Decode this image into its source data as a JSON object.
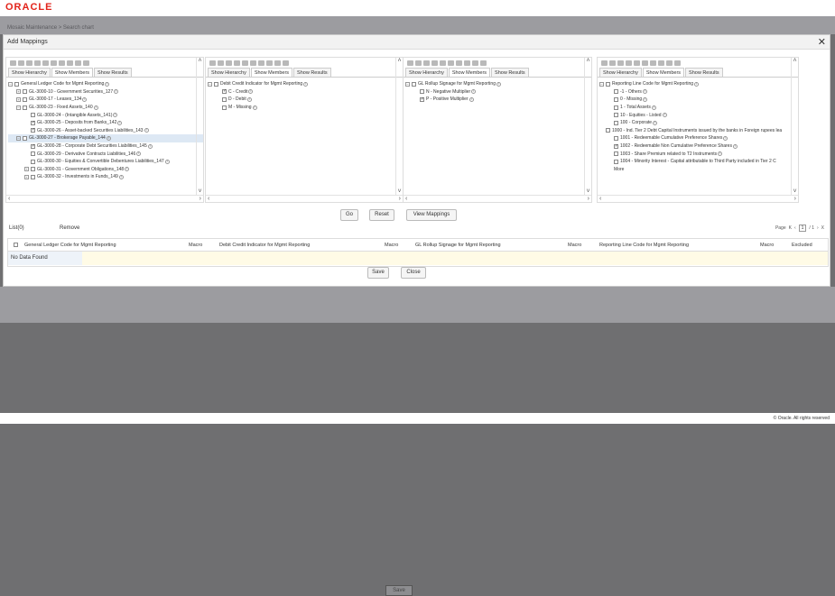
{
  "brand": {
    "logo_text": "ORACLE",
    "logo_color": "#e2231a"
  },
  "background": {
    "breadcrumb": "Mosaic Maintenance  >  Search  chart",
    "save_label": "Save"
  },
  "footer": {
    "copyright": "© Oracle. All rights reserved"
  },
  "modal": {
    "title": "Add Mappings",
    "close_icon": "✕"
  },
  "tabs": {
    "hierarchy": "Show Hierarchy",
    "members": "Show Members",
    "results": "Show Results"
  },
  "panels": [
    {
      "nodes": [
        {
          "indent": 0,
          "expander": "−",
          "checked": false,
          "label": "General Ledger Code for Mgmt Reporting",
          "info": true
        },
        {
          "indent": 1,
          "expander": "+",
          "checked": false,
          "label": "GL-3000-10 - Government Securities_127",
          "info": true
        },
        {
          "indent": 1,
          "expander": "+",
          "checked": false,
          "label": "GL-3000-17 - Leases_134",
          "info": true
        },
        {
          "indent": 1,
          "expander": "−",
          "checked": false,
          "label": "GL-3000-23 - Fixed Assets_140",
          "info": true
        },
        {
          "indent": 2,
          "expander": "",
          "checked": false,
          "label": "GL-3000-24 - (Intangible Assets_141)",
          "info": true
        },
        {
          "indent": 2,
          "expander": "",
          "checked": true,
          "label": "GL-3000-25 - Deposits from Banks_142",
          "info": true
        },
        {
          "indent": 2,
          "expander": "",
          "checked": true,
          "label": "GL-3000-26 - Asset-backed Securities Liabilities_143",
          "info": true
        },
        {
          "indent": 1,
          "expander": "−",
          "checked": false,
          "label": "GL-3000-27 - Brokerage Payable_144",
          "info": true,
          "selected": true
        },
        {
          "indent": 2,
          "expander": "",
          "checked": true,
          "label": "GL-3000-28 - Corporate Debt Securities Liabilities_145",
          "info": true
        },
        {
          "indent": 2,
          "expander": "",
          "checked": false,
          "label": "GL-3000-29 - Derivative Contracts Liabilities_146",
          "info": true
        },
        {
          "indent": 2,
          "expander": "",
          "checked": false,
          "label": "GL-3000-30 - Equities & Convertible Debentures Liabilities_147",
          "info": true
        },
        {
          "indent": 2,
          "expander": "+",
          "checked": false,
          "label": "GL-3000-31 - Government Obligations_148",
          "info": true
        },
        {
          "indent": 2,
          "expander": "+",
          "checked": false,
          "label": "GL-3000-32 - Investments in Funds_149",
          "info": true
        }
      ]
    },
    {
      "nodes": [
        {
          "indent": 0,
          "expander": "−",
          "checked": false,
          "label": "Debit Credit Indicator for Mgmt Reporting",
          "info": true
        },
        {
          "indent": 1,
          "expander": "",
          "checked": true,
          "label": "C - Credit",
          "info": true
        },
        {
          "indent": 1,
          "expander": "",
          "checked": false,
          "label": "D - Debit",
          "info": true
        },
        {
          "indent": 1,
          "expander": "",
          "checked": false,
          "label": "M - Missing",
          "info": true
        }
      ]
    },
    {
      "nodes": [
        {
          "indent": 0,
          "expander": "−",
          "checked": false,
          "label": "GL Rollup Signage for Mgmt Reporting",
          "info": true
        },
        {
          "indent": 1,
          "expander": "",
          "checked": false,
          "label": "N - Negative Multiplier",
          "info": true
        },
        {
          "indent": 1,
          "expander": "",
          "checked": true,
          "label": "P - Positive Multiplier",
          "info": true
        }
      ]
    },
    {
      "nodes": [
        {
          "indent": 0,
          "expander": "−",
          "checked": false,
          "label": "Reporting Line Code for Mgmt Reporting",
          "info": true
        },
        {
          "indent": 1,
          "expander": "",
          "checked": false,
          "label": "-1 - Others",
          "info": true
        },
        {
          "indent": 1,
          "expander": "",
          "checked": false,
          "label": "0 - Missing",
          "info": true
        },
        {
          "indent": 1,
          "expander": "",
          "checked": false,
          "label": "1 - Total Assets",
          "info": true
        },
        {
          "indent": 1,
          "expander": "",
          "checked": false,
          "label": "10 - Equities - Listed",
          "info": true
        },
        {
          "indent": 1,
          "expander": "",
          "checked": false,
          "label": "100 - Corporate",
          "info": true
        },
        {
          "indent": 0,
          "expander": "",
          "checked": false,
          "label": "1000 - Ind. Tier 2 Debt Capital Instruments issued by the banks in Foreign rupees lea",
          "info": false
        },
        {
          "indent": 1,
          "expander": "",
          "checked": false,
          "label": "1001 - Redeemable Cumulative Preference Shares",
          "info": true
        },
        {
          "indent": 1,
          "expander": "",
          "checked": true,
          "label": "1002 - Redeemable Non Cumulative Preference Shares",
          "info": true
        },
        {
          "indent": 1,
          "expander": "",
          "checked": false,
          "label": "1003 - Share Premium related to T2 Instruments",
          "info": true
        },
        {
          "indent": 1,
          "expander": "",
          "checked": false,
          "label": "1004 - Minority Interest - Capital attributable to Third Party included in Tier 2 C",
          "info": false
        },
        {
          "indent": 1,
          "expander": "",
          "checked": false,
          "label": "More",
          "info": false,
          "nocb": true
        }
      ]
    }
  ],
  "actions": {
    "go": "Go",
    "reset": "Reset",
    "view_mappings": "View Mappings"
  },
  "list": {
    "label": "List(0)",
    "remove": "Remove",
    "page_label": "Page",
    "page_current": "1",
    "page_total": "/ 1"
  },
  "grid": {
    "columns": [
      "General Ledger Code for Mgmt Reporting",
      "Macro",
      "Debit Credit Indicator for Mgmt Reporting",
      "Macro",
      "GL Rollup Signage for Mgmt Reporting",
      "Macro",
      "Reporting Line Code for Mgmt Reporting",
      "Macro",
      "Excluded"
    ],
    "empty_text": "No Data Found"
  },
  "footer_buttons": {
    "save": "Save",
    "close": "Close"
  }
}
